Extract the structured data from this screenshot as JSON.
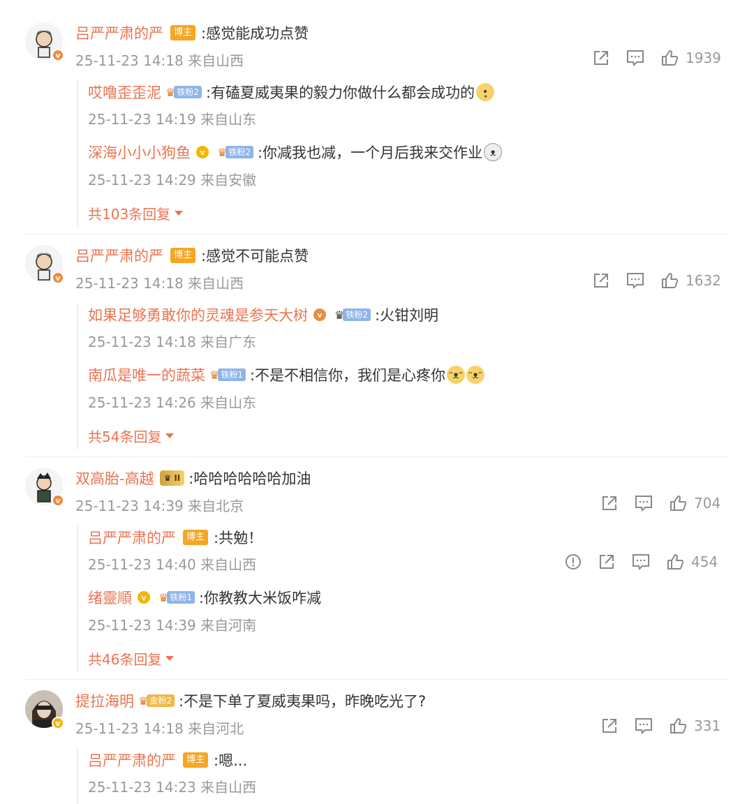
{
  "colors": {
    "name": "#eb7350",
    "meta": "#999999",
    "owner_badge": "#f5a623"
  },
  "comments": [
    {
      "name": "吕严严肃的严",
      "owner_badge": "博主",
      "text": ":感觉能成功点赞",
      "time": "25-11-23 14:18 来自山西",
      "likes": "1939",
      "replies": [
        {
          "name": "哎噜歪歪泥",
          "fan": "铁粉2",
          "text": ":有磕夏威夷果的毅力你做什么都会成功的",
          "time": "25-11-23 14:19 来自山东"
        },
        {
          "name": "深海小小小狗鱼",
          "fan": "铁粉2",
          "text": ":你减我也减，一个月后我来交作业",
          "time": "25-11-23 14:29 来自安徽"
        }
      ],
      "more": "共103条回复"
    },
    {
      "name": "吕严严肃的严",
      "owner_badge": "博主",
      "text": ":感觉不可能点赞",
      "time": "25-11-23 14:18 来自山西",
      "likes": "1632",
      "replies": [
        {
          "name": "如果足够勇敢你的灵魂是参天大树",
          "fan": "铁粉2",
          "text": ":火钳刘明",
          "time": "25-11-23 14:18 来自广东"
        },
        {
          "name": "南瓜是唯一的蔬菜",
          "fan": "铁粉1",
          "text": ":不是不相信你，我们是心疼你",
          "time": "25-11-23 14:26 来自山东"
        }
      ],
      "more": "共54条回复"
    },
    {
      "name": "双高胎-高越",
      "level_badge": "II",
      "text": ":哈哈哈哈哈哈加油",
      "time": "25-11-23 14:39 来自北京",
      "likes": "704",
      "replies": [
        {
          "name": "吕严严肃的严",
          "owner_badge": "博主",
          "text": ":共勉！",
          "time": "25-11-23 14:40 来自山西",
          "likes": "454"
        },
        {
          "name": "绪靈順",
          "fan": "铁粉1",
          "text": ":你教教大米饭咋减",
          "time": "25-11-23 14:39 来自河南"
        }
      ],
      "more": "共46条回复"
    },
    {
      "name": "提拉海明",
      "fan": "金粉2",
      "text": ":不是下单了夏威夷果吗，昨晚吃光了?",
      "time": "25-11-23 14:18 来自河北",
      "likes": "331",
      "replies": [
        {
          "name": "吕严严肃的严",
          "owner_badge": "博主",
          "text": ":嗯...",
          "time": "25-11-23 14:23 来自山西"
        }
      ]
    }
  ]
}
